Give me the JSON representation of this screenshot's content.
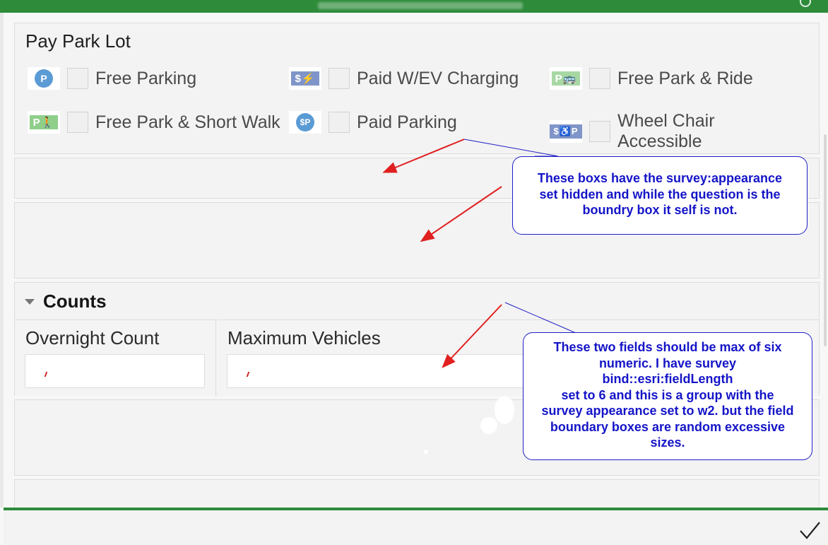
{
  "pay_park": {
    "title": "Pay Park Lot",
    "options": [
      {
        "label": "Free Parking",
        "icon": "free-parking-icon",
        "icon_text": "P",
        "color": "#5b9bd5"
      },
      {
        "label": "Paid W/EV Charging",
        "icon": "paid-ev-charging-icon",
        "icon_text": "$⚡",
        "color": "#7f95c9"
      },
      {
        "label": "Free Park & Ride",
        "icon": "free-park-ride-icon",
        "icon_text": "P🚌",
        "color": "#a7d8a4"
      },
      {
        "label": "Free Park & Short Walk",
        "icon": "free-park-walk-icon",
        "icon_text": "P🚶",
        "color": "#8fcf8a"
      },
      {
        "label": "Paid Parking",
        "icon": "paid-parking-icon",
        "icon_text": "$P",
        "color": "#5b9bd5"
      },
      {
        "label": "Wheel Chair Accessible",
        "icon": "wheelchair-accessible-icon",
        "icon_text": "$♿P",
        "color": "#7f95c9"
      }
    ]
  },
  "counts": {
    "title": "Counts",
    "fields": [
      {
        "label": "Overnight Count",
        "value": ""
      },
      {
        "label": "Maximum Vehicles",
        "value": ""
      }
    ]
  },
  "annotations": {
    "callout_1": [
      "These boxs have the survey:appearance",
      "set hidden and while the question is the",
      "boundry box it self is not."
    ],
    "callout_2": [
      "These two fields should be max of six",
      "numeric. I have survey",
      "bind::esri:fieldLength",
      " set to 6 and this is a group with the",
      "survey appearance set to w2. but the field",
      "boundary boxes are random excessive",
      "sizes."
    ]
  },
  "colors": {
    "header_green": "#2e8b3a",
    "callout_blue": "#1414c8",
    "arrow_red": "#e02020"
  },
  "icons": {
    "submit": "checkmark-icon",
    "collapse": "caret-down-icon"
  }
}
